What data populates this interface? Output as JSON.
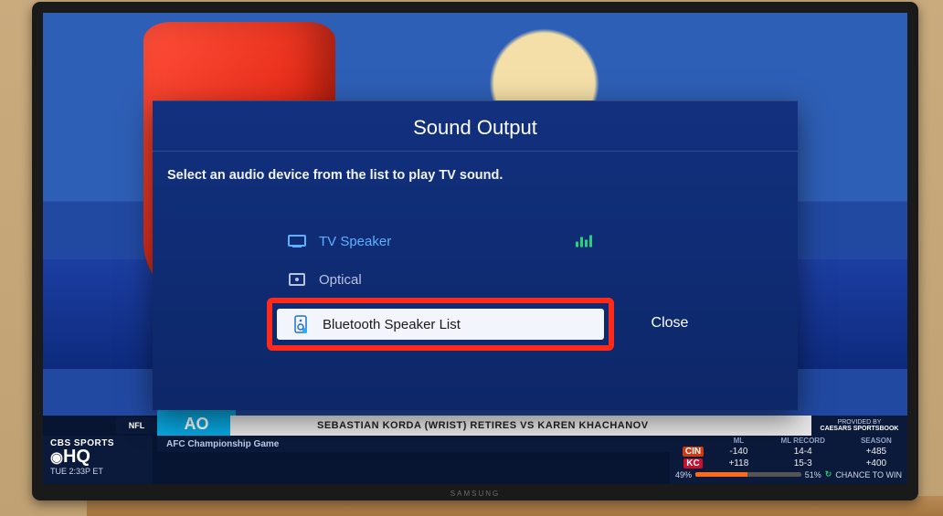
{
  "dialog": {
    "title": "Sound Output",
    "subtitle": "Select an audio device from the list to play TV sound.",
    "options": {
      "tv_speaker": "TV Speaker",
      "optical": "Optical",
      "bluetooth": "Bluetooth Speaker List"
    },
    "close_label": "Close"
  },
  "chyron": {
    "ao": "AO",
    "nfl_tag": "NFL",
    "headline": "SEBASTIAN KORDA (WRIST) RETIRES VS KAREN KHACHANOV",
    "subline": "AFC Championship Game",
    "network_line1": "CBS SPORTS",
    "network_hq": "HQ",
    "clock": "TUE 2:33P ET",
    "odds_headers": {
      "ml": "ML",
      "rec": "ML RECORD",
      "season": "SEASON"
    },
    "odds": [
      {
        "sym": "CIN",
        "ml": "-140",
        "rec": "14-4",
        "season": "+485"
      },
      {
        "sym": "KC",
        "ml": "+118",
        "rec": "15-3",
        "season": "+400"
      }
    ],
    "win_left": "49%",
    "win_right": "51%",
    "win_left_num": 49,
    "chance_label": "CHANCE TO WIN",
    "provider_top": "PROVIDED BY",
    "provider_name": "CAESARS SPORTSBOOK"
  },
  "tv_brand": "SAMSUNG"
}
